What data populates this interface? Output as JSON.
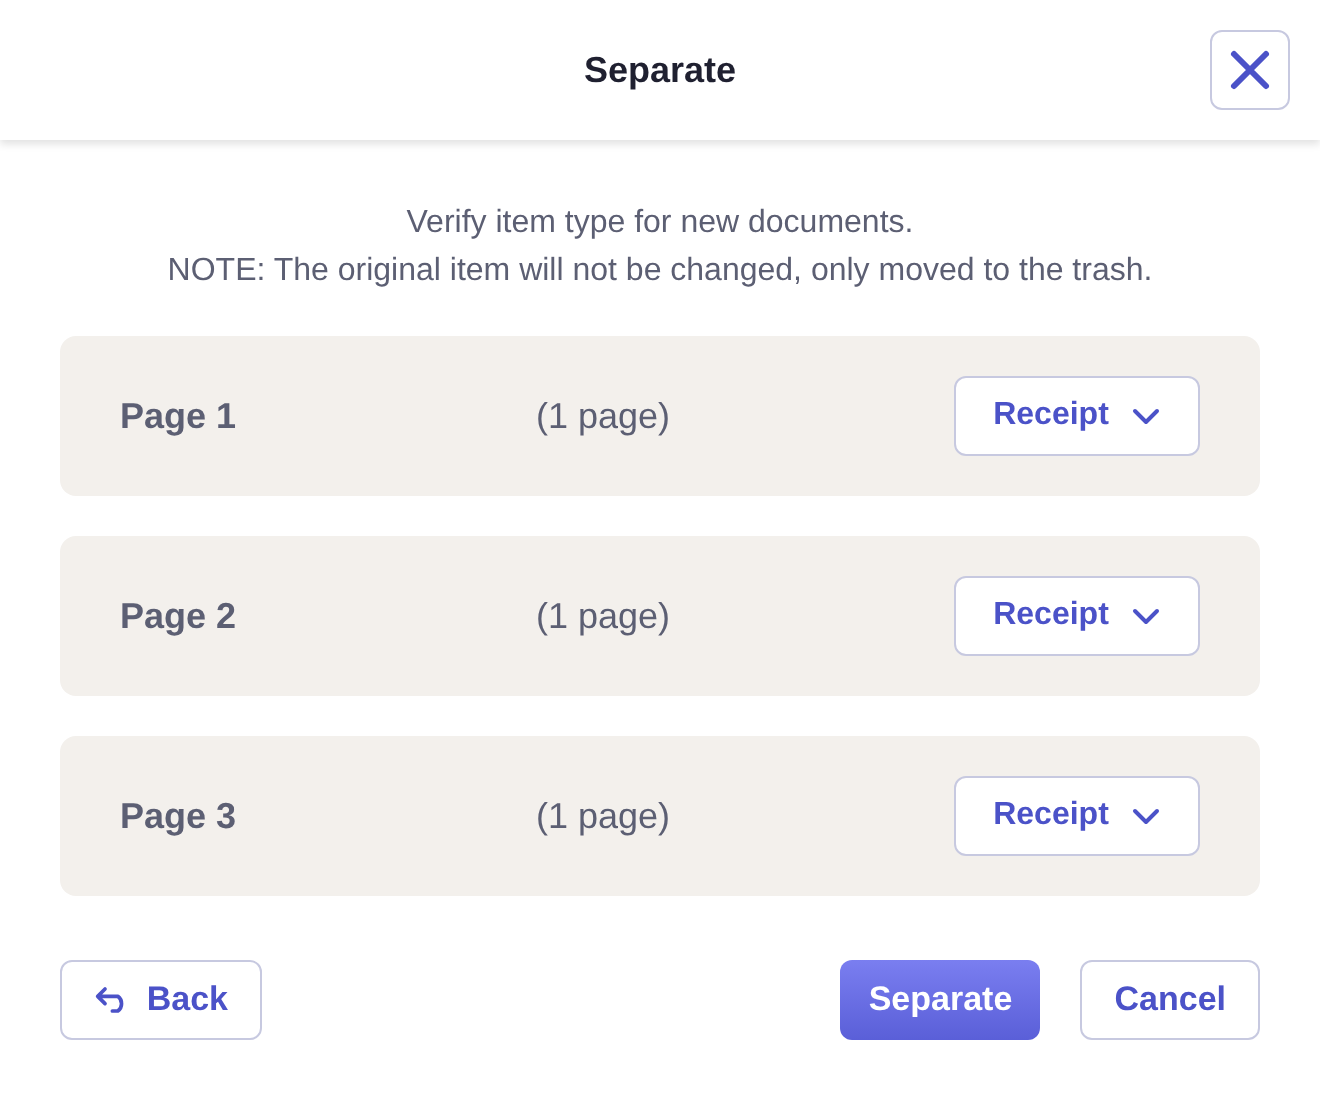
{
  "dialog": {
    "title": "Separate"
  },
  "description": [
    "Verify item type for new documents.",
    "NOTE: The original item will not be changed, only moved to the trash."
  ],
  "pages": [
    {
      "name": "Page 1",
      "count": "(1 page)",
      "type": "Receipt"
    },
    {
      "name": "Page 2",
      "count": "(1 page)",
      "type": "Receipt"
    },
    {
      "name": "Page 3",
      "count": "(1 page)",
      "type": "Receipt"
    }
  ],
  "buttons": [
    {
      "kind": "back",
      "label": "Back"
    },
    {
      "kind": "primary",
      "label": "Separate"
    },
    {
      "kind": "secondary",
      "label": "Cancel"
    }
  ]
}
